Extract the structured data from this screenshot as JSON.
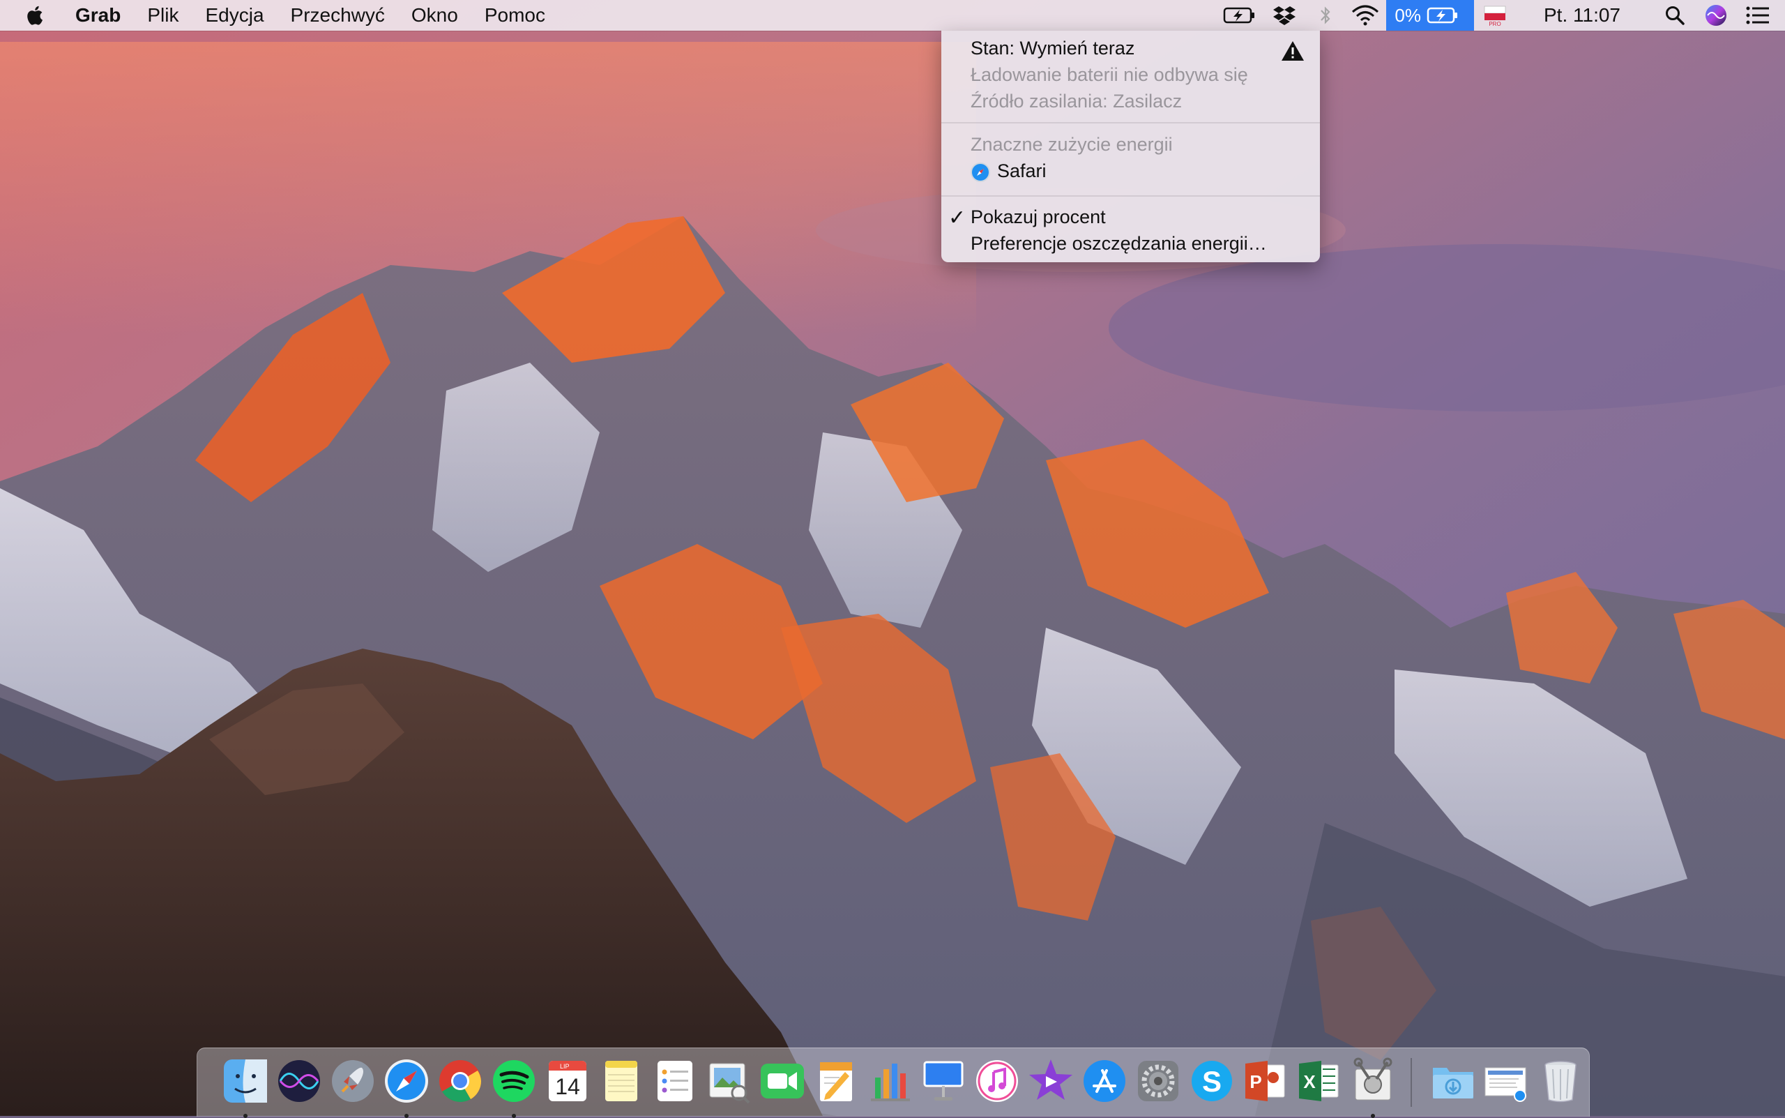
{
  "menubar": {
    "app_name": "Grab",
    "menus": [
      "Plik",
      "Edycja",
      "Przechwyć",
      "Okno",
      "Pomoc"
    ],
    "battery_percent": "0%",
    "clock": "Pt. 11:07",
    "status_icons": [
      "battery-charging-icon",
      "dropbox-icon",
      "bluetooth-icon",
      "wifi-icon",
      "battery-icon",
      "polish-flag-pro-icon",
      "spotlight-search-icon",
      "siri-icon",
      "notification-center-icon"
    ]
  },
  "battery_menu": {
    "status": "Stan: Wymień teraz",
    "charging": "Ładowanie baterii nie odbywa się",
    "source": "Źródło zasilania: Zasilacz",
    "energy_header": "Znaczne zużycie energii",
    "energy_app": "Safari",
    "show_percent": "Pokazuj procent",
    "preferences": "Preferencje oszczędzania energii…"
  },
  "dock": {
    "calendar_month": "LIP",
    "calendar_day": "14",
    "apps": [
      "Finder",
      "Siri",
      "Launchpad",
      "Safari",
      "Chrome",
      "Spotify",
      "Kalendarz",
      "Notatki",
      "Przypomnienia",
      "Podgląd",
      "FaceTime",
      "Pages",
      "Numbers",
      "Keynote",
      "iTunes",
      "iMovie",
      "App Store",
      "Preferencje systemowe",
      "Skype",
      "PowerPoint",
      "Excel",
      "Grab",
      "Pobrane",
      "Dokumenty",
      "Kosz"
    ]
  }
}
